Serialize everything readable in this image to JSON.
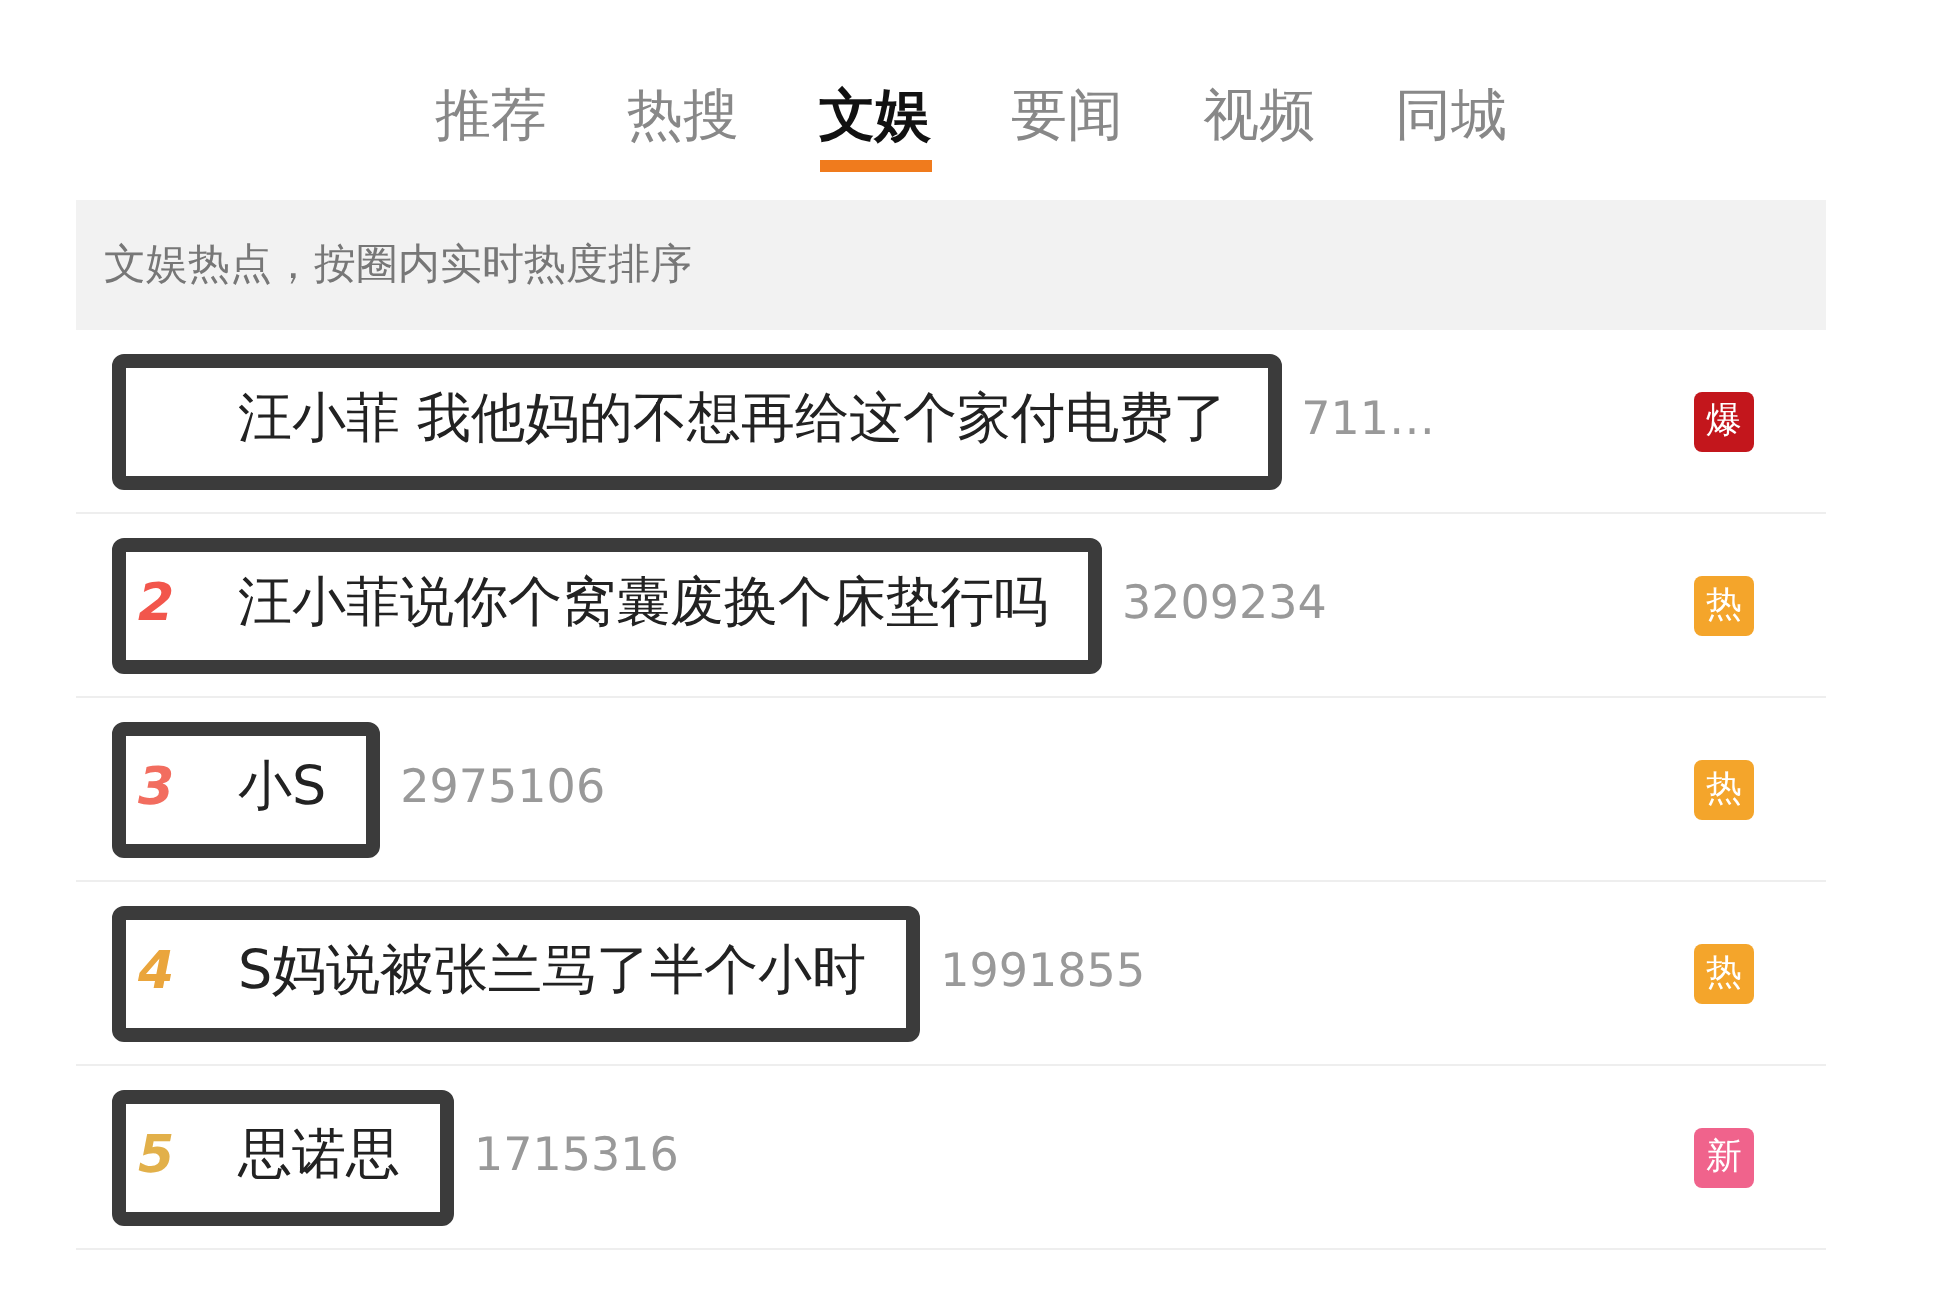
{
  "tabs": [
    {
      "label": "推荐",
      "selected": false
    },
    {
      "label": "热搜",
      "selected": false
    },
    {
      "label": "文娱",
      "selected": true
    },
    {
      "label": "要闻",
      "selected": false
    },
    {
      "label": "视频",
      "selected": false
    },
    {
      "label": "同城",
      "selected": false
    }
  ],
  "section_header": "文娱热点，按圈内实时热度排序",
  "rows": [
    {
      "title": "汪小菲 我他妈的不想再给这个家付电费了",
      "count": "711…",
      "badge": "爆",
      "color": "#c3161c",
      "annotated": true
    },
    {
      "rank": "2",
      "title": "汪小菲说你个窝囊废换个床垫行吗",
      "count": "3209234",
      "badge": "热",
      "color": "#f4a52b",
      "annotated": true
    },
    {
      "rank": "3",
      "title": "小S",
      "count": "2975106",
      "badge": "热",
      "color": "#f4a52b",
      "annotated": true
    },
    {
      "rank": "4",
      "title": "S妈说被张兰骂了半个小时",
      "count": "1991855",
      "badge": "热",
      "color": "#f4a52b",
      "annotated": true
    },
    {
      "rank": "5",
      "title": "思诺思",
      "count": "1715316",
      "badge": "新",
      "color": "#f0638c",
      "annotated": true
    }
  ]
}
